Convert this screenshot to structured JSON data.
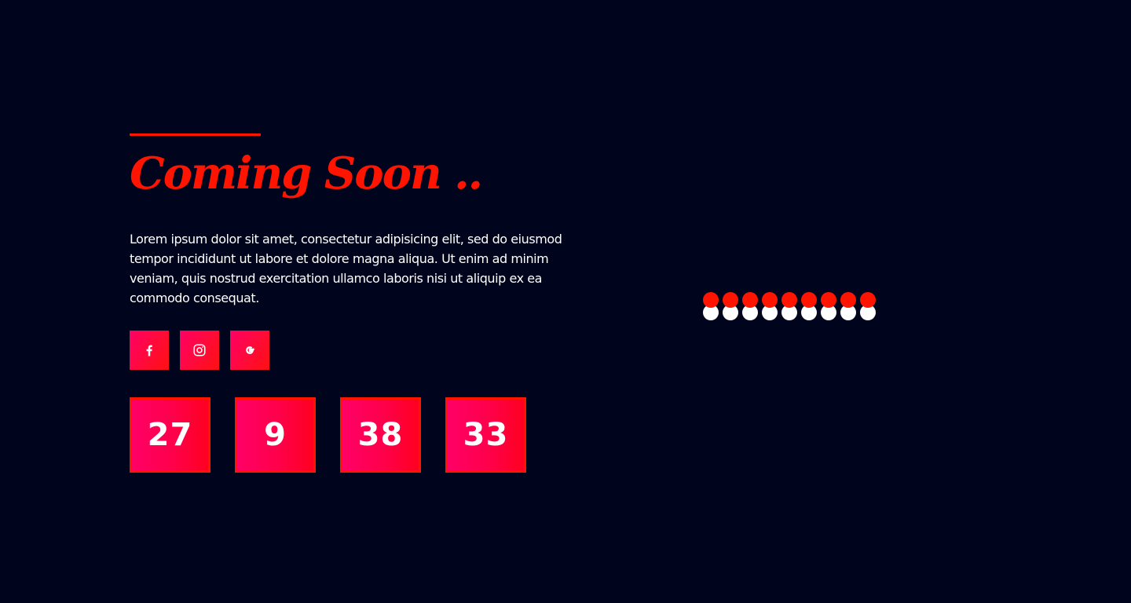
{
  "hero": {
    "title": "Coming Soon ..",
    "description": "Lorem ipsum dolor sit amet, consectetur adipisicing elit, sed do eiusmod tempor incididunt ut labore et dolore magna aliqua. Ut enim ad minim veniam, quis nostrud exercitation ullamco laboris nisi ut aliquip ex ea commodo consequat."
  },
  "social": [
    {
      "icon": "facebook-icon"
    },
    {
      "icon": "instagram-icon"
    },
    {
      "icon": "google-icon"
    }
  ],
  "countdown": [
    "27",
    "9",
    "38",
    "33"
  ],
  "loader": {
    "dot_count": 9
  },
  "colors": {
    "background": "#00041c",
    "accent": "#ff1400",
    "gradient_start": "#ff0066",
    "gradient_end": "#ff0020",
    "text": "#ffffff"
  }
}
